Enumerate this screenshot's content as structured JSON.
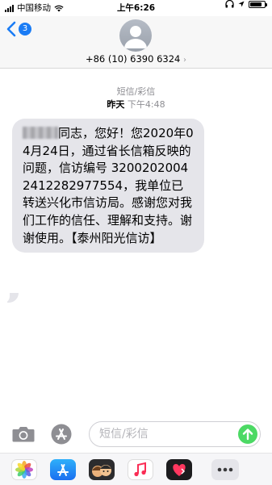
{
  "status_bar": {
    "carrier": "中国移动",
    "time": "上午6:26",
    "battery_level": 0.85
  },
  "header": {
    "back_badge": "3",
    "contact": "+86 (10) 6390 6324"
  },
  "thread": {
    "label": "短信/彩信",
    "date": "昨天",
    "time": "下午4:48"
  },
  "message": {
    "text_after_redaction": "同志，您好！您2020年04月24日，通过省长信箱反映的问题，信访编号 32002020042412282977554，我单位已转送兴化市信访局。感谢您对我们工作的信任、理解和支持。谢谢使用。【泰州阳光信访】"
  },
  "input": {
    "placeholder": "短信/彩信"
  },
  "app_drawer": {
    "apps": [
      "photos-icon",
      "app-store-icon",
      "memoji-icon",
      "music-icon",
      "digital-touch-icon",
      "more-icon"
    ]
  },
  "colors": {
    "accent": "#1a7cf5",
    "send": "#4cd964",
    "bubble": "#e5e5ea"
  }
}
